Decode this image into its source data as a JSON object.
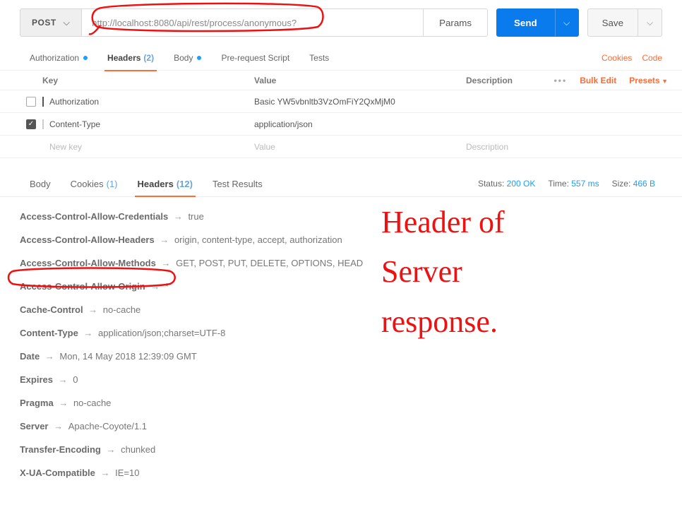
{
  "request": {
    "method": "POST",
    "url": "http://localhost:8080/api/rest/process/anonymous?",
    "params_label": "Params",
    "send_label": "Send",
    "save_label": "Save"
  },
  "req_tabs": {
    "authorization": "Authorization",
    "headers": "Headers",
    "headers_count": "(2)",
    "body": "Body",
    "pre_request": "Pre-request Script",
    "tests": "Tests",
    "cookies_link": "Cookies",
    "code_link": "Code"
  },
  "thead": {
    "key": "Key",
    "value": "Value",
    "description": "Description",
    "bulk": "Bulk Edit",
    "presets": "Presets"
  },
  "req_headers": [
    {
      "checked": false,
      "key": "Authorization",
      "value": "Basic YW5vbnltb3VzOmFiY2QxMjM0",
      "desc": ""
    },
    {
      "checked": true,
      "key": "Content-Type",
      "value": "application/json",
      "desc": ""
    }
  ],
  "req_ghost": {
    "key": "New key",
    "value": "Value",
    "description": "Description"
  },
  "resp_tabs": {
    "body": "Body",
    "cookies": "Cookies",
    "cookies_count": "(1)",
    "headers": "Headers",
    "headers_count": "(12)",
    "test_results": "Test Results"
  },
  "resp_meta": {
    "status_label": "Status:",
    "status_value": "200 OK",
    "time_label": "Time:",
    "time_value": "557 ms",
    "size_label": "Size:",
    "size_value": "466 B"
  },
  "resp_headers": [
    {
      "name": "Access-Control-Allow-Credentials",
      "value": "true"
    },
    {
      "name": "Access-Control-Allow-Headers",
      "value": "origin, content-type, accept, authorization"
    },
    {
      "name": "Access-Control-Allow-Methods",
      "value": "GET, POST, PUT, DELETE, OPTIONS, HEAD"
    },
    {
      "name": "Access-Control-Allow-Origin",
      "value": "*"
    },
    {
      "name": "Cache-Control",
      "value": "no-cache"
    },
    {
      "name": "Content-Type",
      "value": "application/json;charset=UTF-8"
    },
    {
      "name": "Date",
      "value": "Mon, 14 May 2018 12:39:09 GMT"
    },
    {
      "name": "Expires",
      "value": "0"
    },
    {
      "name": "Pragma",
      "value": "no-cache"
    },
    {
      "name": "Server",
      "value": "Apache-Coyote/1.1"
    },
    {
      "name": "Transfer-Encoding",
      "value": "chunked"
    },
    {
      "name": "X-UA-Compatible",
      "value": "IE=10"
    }
  ],
  "annotation_text": {
    "l1": "Header of",
    "l2": "Server",
    "l3": "response."
  }
}
